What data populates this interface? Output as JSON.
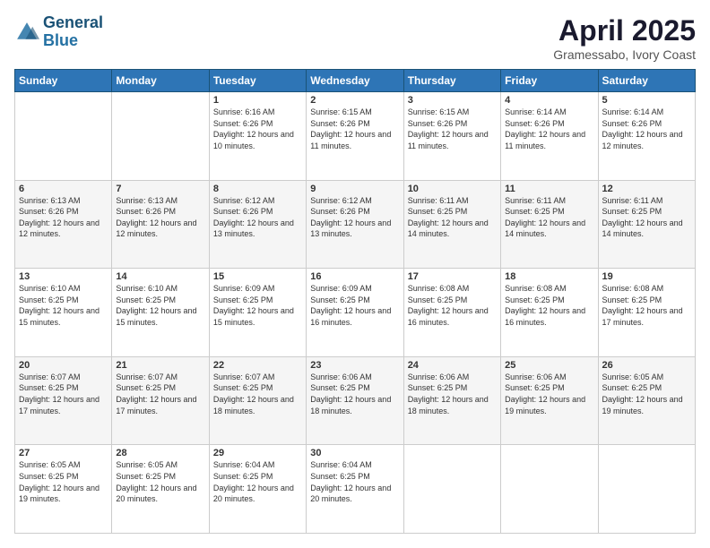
{
  "header": {
    "logo_line1": "General",
    "logo_line2": "Blue",
    "month": "April 2025",
    "location": "Gramessabo, Ivory Coast"
  },
  "days_of_week": [
    "Sunday",
    "Monday",
    "Tuesday",
    "Wednesday",
    "Thursday",
    "Friday",
    "Saturday"
  ],
  "weeks": [
    [
      {
        "day": "",
        "info": ""
      },
      {
        "day": "",
        "info": ""
      },
      {
        "day": "1",
        "info": "Sunrise: 6:16 AM\nSunset: 6:26 PM\nDaylight: 12 hours and 10 minutes."
      },
      {
        "day": "2",
        "info": "Sunrise: 6:15 AM\nSunset: 6:26 PM\nDaylight: 12 hours and 11 minutes."
      },
      {
        "day": "3",
        "info": "Sunrise: 6:15 AM\nSunset: 6:26 PM\nDaylight: 12 hours and 11 minutes."
      },
      {
        "day": "4",
        "info": "Sunrise: 6:14 AM\nSunset: 6:26 PM\nDaylight: 12 hours and 11 minutes."
      },
      {
        "day": "5",
        "info": "Sunrise: 6:14 AM\nSunset: 6:26 PM\nDaylight: 12 hours and 12 minutes."
      }
    ],
    [
      {
        "day": "6",
        "info": "Sunrise: 6:13 AM\nSunset: 6:26 PM\nDaylight: 12 hours and 12 minutes."
      },
      {
        "day": "7",
        "info": "Sunrise: 6:13 AM\nSunset: 6:26 PM\nDaylight: 12 hours and 12 minutes."
      },
      {
        "day": "8",
        "info": "Sunrise: 6:12 AM\nSunset: 6:26 PM\nDaylight: 12 hours and 13 minutes."
      },
      {
        "day": "9",
        "info": "Sunrise: 6:12 AM\nSunset: 6:26 PM\nDaylight: 12 hours and 13 minutes."
      },
      {
        "day": "10",
        "info": "Sunrise: 6:11 AM\nSunset: 6:25 PM\nDaylight: 12 hours and 14 minutes."
      },
      {
        "day": "11",
        "info": "Sunrise: 6:11 AM\nSunset: 6:25 PM\nDaylight: 12 hours and 14 minutes."
      },
      {
        "day": "12",
        "info": "Sunrise: 6:11 AM\nSunset: 6:25 PM\nDaylight: 12 hours and 14 minutes."
      }
    ],
    [
      {
        "day": "13",
        "info": "Sunrise: 6:10 AM\nSunset: 6:25 PM\nDaylight: 12 hours and 15 minutes."
      },
      {
        "day": "14",
        "info": "Sunrise: 6:10 AM\nSunset: 6:25 PM\nDaylight: 12 hours and 15 minutes."
      },
      {
        "day": "15",
        "info": "Sunrise: 6:09 AM\nSunset: 6:25 PM\nDaylight: 12 hours and 15 minutes."
      },
      {
        "day": "16",
        "info": "Sunrise: 6:09 AM\nSunset: 6:25 PM\nDaylight: 12 hours and 16 minutes."
      },
      {
        "day": "17",
        "info": "Sunrise: 6:08 AM\nSunset: 6:25 PM\nDaylight: 12 hours and 16 minutes."
      },
      {
        "day": "18",
        "info": "Sunrise: 6:08 AM\nSunset: 6:25 PM\nDaylight: 12 hours and 16 minutes."
      },
      {
        "day": "19",
        "info": "Sunrise: 6:08 AM\nSunset: 6:25 PM\nDaylight: 12 hours and 17 minutes."
      }
    ],
    [
      {
        "day": "20",
        "info": "Sunrise: 6:07 AM\nSunset: 6:25 PM\nDaylight: 12 hours and 17 minutes."
      },
      {
        "day": "21",
        "info": "Sunrise: 6:07 AM\nSunset: 6:25 PM\nDaylight: 12 hours and 17 minutes."
      },
      {
        "day": "22",
        "info": "Sunrise: 6:07 AM\nSunset: 6:25 PM\nDaylight: 12 hours and 18 minutes."
      },
      {
        "day": "23",
        "info": "Sunrise: 6:06 AM\nSunset: 6:25 PM\nDaylight: 12 hours and 18 minutes."
      },
      {
        "day": "24",
        "info": "Sunrise: 6:06 AM\nSunset: 6:25 PM\nDaylight: 12 hours and 18 minutes."
      },
      {
        "day": "25",
        "info": "Sunrise: 6:06 AM\nSunset: 6:25 PM\nDaylight: 12 hours and 19 minutes."
      },
      {
        "day": "26",
        "info": "Sunrise: 6:05 AM\nSunset: 6:25 PM\nDaylight: 12 hours and 19 minutes."
      }
    ],
    [
      {
        "day": "27",
        "info": "Sunrise: 6:05 AM\nSunset: 6:25 PM\nDaylight: 12 hours and 19 minutes."
      },
      {
        "day": "28",
        "info": "Sunrise: 6:05 AM\nSunset: 6:25 PM\nDaylight: 12 hours and 20 minutes."
      },
      {
        "day": "29",
        "info": "Sunrise: 6:04 AM\nSunset: 6:25 PM\nDaylight: 12 hours and 20 minutes."
      },
      {
        "day": "30",
        "info": "Sunrise: 6:04 AM\nSunset: 6:25 PM\nDaylight: 12 hours and 20 minutes."
      },
      {
        "day": "",
        "info": ""
      },
      {
        "day": "",
        "info": ""
      },
      {
        "day": "",
        "info": ""
      }
    ]
  ]
}
